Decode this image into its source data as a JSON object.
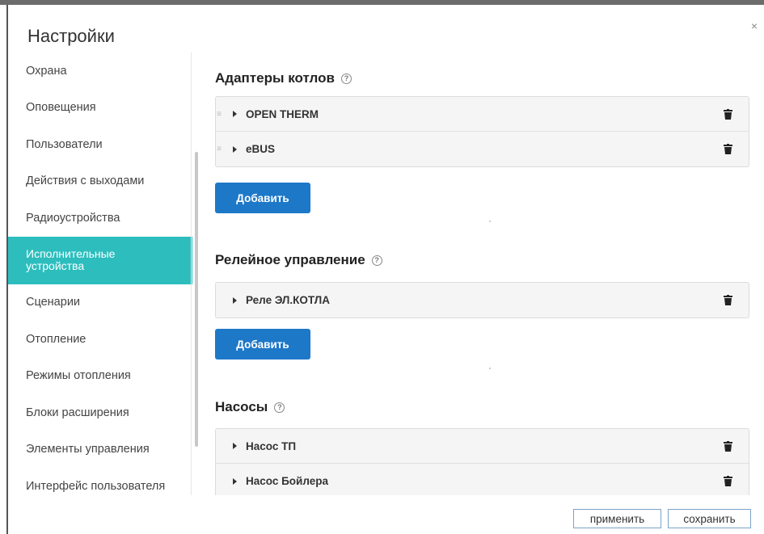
{
  "dialog": {
    "title": "Настройки",
    "close_label": "×"
  },
  "sidebar": {
    "items": [
      {
        "label": "Охрана"
      },
      {
        "label": "Оповещения"
      },
      {
        "label": "Пользователи"
      },
      {
        "label": "Действия с выходами"
      },
      {
        "label": "Радиоустройства"
      },
      {
        "label": "Исполнительные устройства",
        "active": true
      },
      {
        "label": "Сценарии"
      },
      {
        "label": "Отопление"
      },
      {
        "label": "Режимы отопления"
      },
      {
        "label": "Блоки расширения"
      },
      {
        "label": "Элементы управления"
      },
      {
        "label": "Интерфейс пользователя"
      }
    ]
  },
  "sections": {
    "adapters": {
      "title": "Адаптеры котлов",
      "help": "?",
      "items": [
        "OPEN THERM",
        "eBUS"
      ],
      "add_label": "Добавить"
    },
    "relay": {
      "title": "Релейное управление",
      "help": "?",
      "items": [
        "Реле ЭЛ.КОТЛА"
      ],
      "add_label": "Добавить"
    },
    "pumps": {
      "title": "Насосы",
      "help": "?",
      "items": [
        "Насос ТП",
        "Насос Бойлера"
      ]
    }
  },
  "footer": {
    "apply_label": "применить",
    "save_label": "сохранить"
  },
  "colors": {
    "accent_active": "#2dbdbd",
    "button_primary": "#1e78c8"
  }
}
